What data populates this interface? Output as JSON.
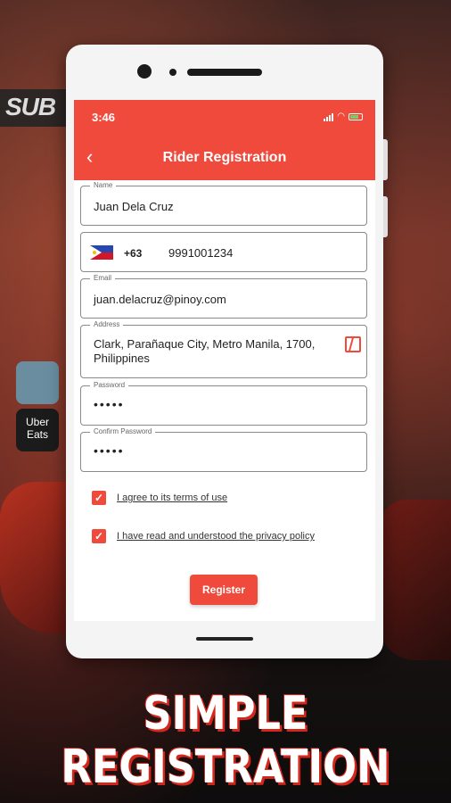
{
  "status_bar": {
    "time": "3:46"
  },
  "header": {
    "title": "Rider Registration",
    "back_icon": "chevron-left-icon"
  },
  "form": {
    "name": {
      "label": "Name",
      "value": "Juan Dela Cruz"
    },
    "phone": {
      "country_code": "+63",
      "number": "9991001234"
    },
    "email": {
      "label": "Email",
      "value": "juan.delacruz@pinoy.com"
    },
    "address": {
      "label": "Address",
      "line1": "Clark, Parañaque City, Metro Manila, 1700,",
      "line2": "Philippines"
    },
    "password": {
      "label": "Password",
      "value": "•••••"
    },
    "confirm_password": {
      "label": "Confirm Password",
      "value": "•••••"
    }
  },
  "agreements": [
    {
      "label": "I agree to its terms of use",
      "checked": true
    },
    {
      "label": "I have read and understood the privacy policy",
      "checked": true
    }
  ],
  "register_button": "Register",
  "banner": "SIMPLE REGISTRATION",
  "background": {
    "sign_text": "SUB",
    "tile_text": "Uber Eats"
  },
  "colors": {
    "accent": "#f04a3c",
    "banner_shadow": "#d5261b"
  }
}
